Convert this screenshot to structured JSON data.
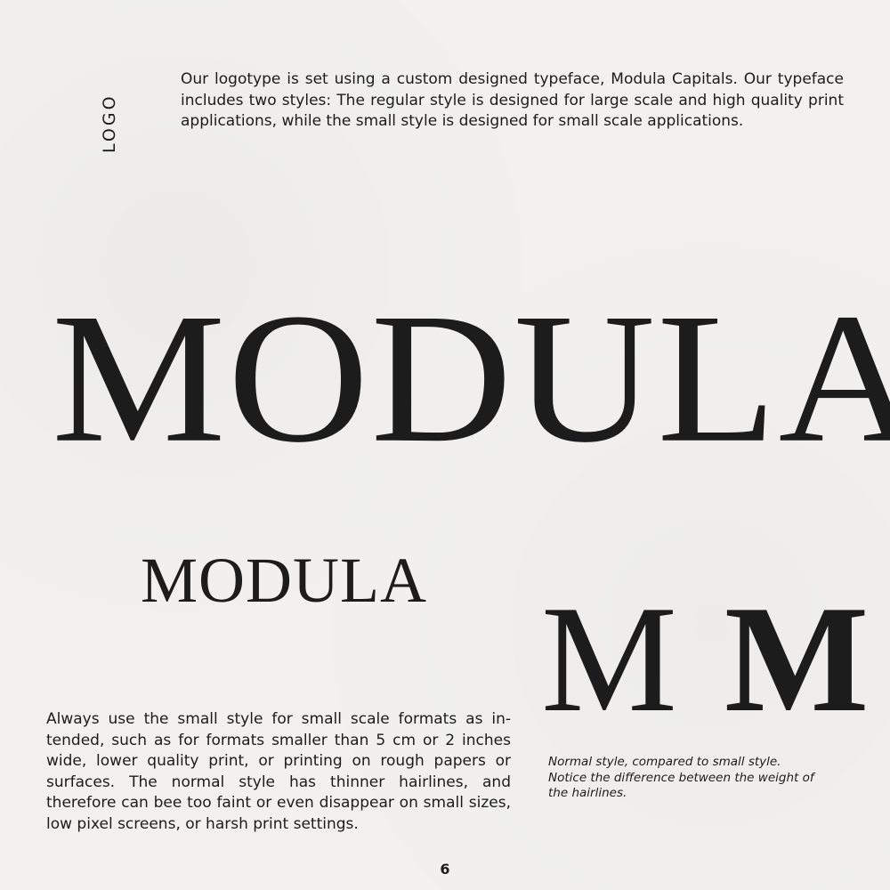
{
  "section": {
    "label": "LOGO"
  },
  "intro": {
    "text": "Our logotype is set using a custom designed typeface, Modula Capitals. Our typeface includes two styles: The regular style is designed for large scale and high quality print applications, while the small style is designed for small scale applications."
  },
  "wordmark": {
    "large": "MODULA",
    "small": "MODULA"
  },
  "comparison": {
    "normal_glyph": "M",
    "small_glyph": "M",
    "caption": "Normal style, compared to small style. Notice the difference between the weight of the hairlines."
  },
  "guidance": {
    "text": "Always use the small style for small scale formats as in-tended, such as for formats smaller than 5 cm or 2 inches wide, lower quality print, or printing on rough papers or surfaces. The normal style has thinner hairlines, and therefore can bee too faint or even disappear on small sizes, low pixel screens, or harsh print settings."
  },
  "footer": {
    "page_number": "6"
  }
}
